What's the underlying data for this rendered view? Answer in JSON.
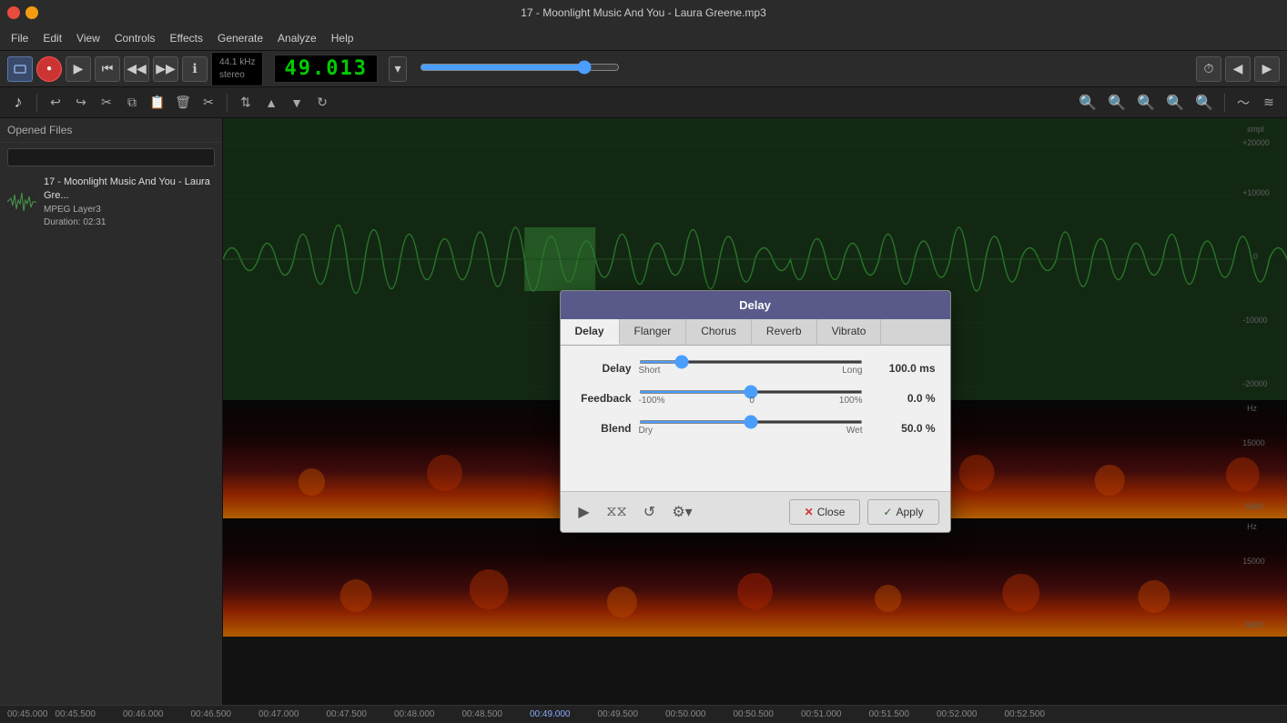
{
  "titlebar": {
    "title": "17 - Moonlight Music And You - Laura Greene.mp3"
  },
  "menubar": {
    "items": [
      "File",
      "Edit",
      "View",
      "Controls",
      "Effects",
      "Generate",
      "Analyze",
      "Help"
    ]
  },
  "transport": {
    "time": "49.013",
    "sample_rate": "44.1 kHz",
    "channels": "stereo",
    "btn_record": "●",
    "btn_play": "▶",
    "btn_back": "⏮",
    "btn_prev": "◀◀",
    "btn_next": "▶▶",
    "btn_info": "ℹ"
  },
  "sidebar": {
    "header": "Opened Files",
    "search_placeholder": "",
    "files": [
      {
        "name": "17 - Moonlight Music And You - Laura Gre...",
        "type": "MPEG Layer3",
        "duration": "Duration: 02:31"
      }
    ]
  },
  "dialog": {
    "title": "Delay",
    "tabs": [
      "Delay",
      "Flanger",
      "Chorus",
      "Reverb",
      "Vibrato"
    ],
    "active_tab": "Delay",
    "parameters": [
      {
        "name": "Delay",
        "value": "100.0 ms",
        "min_label": "Short",
        "max_label": "Long",
        "slider_percent": 17,
        "min": 0,
        "max": 100
      },
      {
        "name": "Feedback",
        "value": "0.0 %",
        "min_label": "-100%",
        "mid_label": "0",
        "max_label": "100%",
        "slider_percent": 50,
        "min": -100,
        "max": 100
      },
      {
        "name": "Blend",
        "value": "50.0 %",
        "min_label": "Dry",
        "max_label": "Wet",
        "slider_percent": 50,
        "min": 0,
        "max": 100
      }
    ],
    "buttons": {
      "close": "Close",
      "apply": "Apply"
    }
  },
  "timeline": {
    "labels": [
      "00:45.000",
      "00:45.500",
      "00:46.000",
      "00:46.500",
      "00:47.000",
      "00:47.500",
      "00:48.000",
      "00:48.500",
      "00:49.000",
      "00:49.500",
      "00:50.000",
      "00:50.500",
      "00:51.000",
      "00:51.500",
      "00:52.000",
      "00:52.500"
    ]
  },
  "scale_labels": {
    "waveform": [
      "+20000",
      "+10000",
      "0",
      "-10000",
      "-20000"
    ],
    "spec_label": "smpl",
    "spec_hz_label": "Hz",
    "spec_values1": [
      "15000",
      "5000"
    ],
    "spec_values2": [
      "15000",
      "5000"
    ]
  }
}
